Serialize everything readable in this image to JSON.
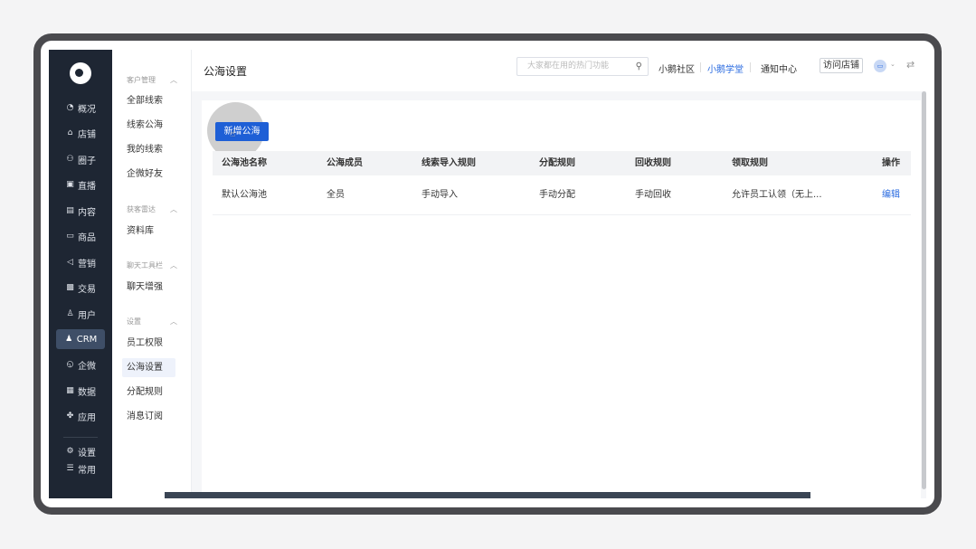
{
  "main_nav": {
    "items": [
      {
        "icon": "pie-chart-icon",
        "glyph": "◔",
        "label": "概况"
      },
      {
        "icon": "store-icon",
        "glyph": "⌂",
        "label": "店铺"
      },
      {
        "icon": "group-icon",
        "glyph": "⚇",
        "label": "圈子"
      },
      {
        "icon": "live-icon",
        "glyph": "▣",
        "label": "直播"
      },
      {
        "icon": "content-icon",
        "glyph": "▤",
        "label": "内容"
      },
      {
        "icon": "product-icon",
        "glyph": "▭",
        "label": "商品"
      },
      {
        "icon": "marketing-icon",
        "glyph": "◁",
        "label": "营销"
      },
      {
        "icon": "trade-icon",
        "glyph": "▩",
        "label": "交易"
      },
      {
        "icon": "user-icon",
        "glyph": "♙",
        "label": "用户"
      },
      {
        "icon": "crm-icon",
        "glyph": "♟",
        "label": "CRM"
      },
      {
        "icon": "wecom-icon",
        "glyph": "◵",
        "label": "企微"
      },
      {
        "icon": "data-icon",
        "glyph": "▦",
        "label": "数据"
      },
      {
        "icon": "apps-icon",
        "glyph": "✤",
        "label": "应用"
      }
    ],
    "bottom": [
      {
        "icon": "gear-icon",
        "glyph": "⚙",
        "label": "设置"
      },
      {
        "icon": "list-icon",
        "glyph": "☰",
        "label": "常用"
      }
    ]
  },
  "sub_nav": {
    "groups": [
      {
        "title": "客户管理",
        "items": [
          "全部线索",
          "线索公海",
          "我的线索",
          "企微好友"
        ]
      },
      {
        "title": "获客雷达",
        "items": [
          "资料库"
        ]
      },
      {
        "title": "聊天工具栏",
        "items": [
          "聊天增强"
        ]
      },
      {
        "title": "设置",
        "items": [
          "员工权限",
          "公海设置",
          "分配规则",
          "消息订阅"
        ]
      }
    ],
    "active": "公海设置"
  },
  "topbar": {
    "title": "公海设置",
    "search_placeholder": "大家都在用的热门功能",
    "links": [
      "小鹅社区",
      "小鹅学堂",
      "通知中心"
    ],
    "visit_store": "访问店铺",
    "chevron": "⌄",
    "swap": "⇄"
  },
  "toolbar": {
    "new_button": "新增公海"
  },
  "table": {
    "headers": [
      "公海池名称",
      "公海成员",
      "线索导入规则",
      "分配规则",
      "回收规则",
      "领取规则",
      "操作"
    ],
    "rows": [
      [
        "默认公海池",
        "全员",
        "手动导入",
        "手动分配",
        "手动回收",
        "允许员工认领（无上...",
        "编辑"
      ]
    ]
  }
}
